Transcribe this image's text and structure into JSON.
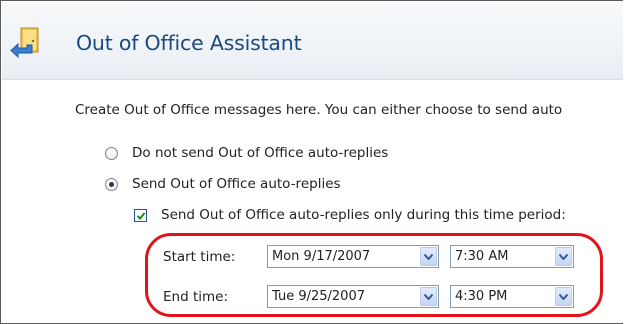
{
  "header": {
    "title": "Out of Office Assistant",
    "icon": "out-of-office-door-arrow-icon"
  },
  "intro_text": "Create Out of Office messages here. You can either choose to send auto",
  "options": {
    "do_not_send": "Do not send Out of Office auto-replies",
    "send": "Send Out of Office auto-replies",
    "selected": "send"
  },
  "time_period": {
    "label": "Send Out of Office auto-replies only during this time period:",
    "checked": true
  },
  "start": {
    "label": "Start time:",
    "date": "Mon 9/17/2007",
    "time": "7:30 AM"
  },
  "end": {
    "label": "End time:",
    "date": "Tue 9/25/2007",
    "time": "4:30 PM"
  },
  "colors": {
    "title": "#1b4a82",
    "highlight": "#e1141c",
    "select_border": "#7f9db9"
  }
}
